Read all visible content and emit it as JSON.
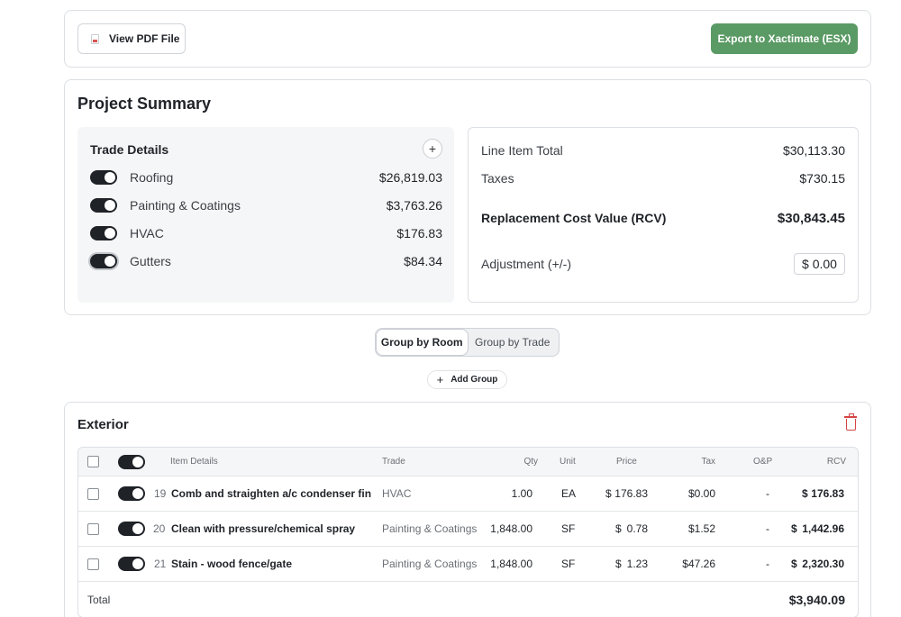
{
  "toolbar": {
    "view_pdf_label": "View PDF File",
    "export_label": "Export to Xactimate (ESX)",
    "accent_color": "#5a9a64"
  },
  "summary": {
    "title": "Project Summary",
    "trade_details": {
      "heading": "Trade Details",
      "add_icon": "plus-icon",
      "items": [
        {
          "name": "Roofing",
          "amount": "$26,819.03",
          "enabled": true
        },
        {
          "name": "Painting & Coatings",
          "amount": "$3,763.26",
          "enabled": true
        },
        {
          "name": "HVAC",
          "amount": "$176.83",
          "enabled": true
        },
        {
          "name": "Gutters",
          "amount": "$84.34",
          "enabled": true
        }
      ]
    },
    "totals": {
      "line_item_label": "Line Item Total",
      "line_item_value": "$30,113.30",
      "taxes_label": "Taxes",
      "taxes_value": "$730.15",
      "rcv_label": "Replacement Cost Value (RCV)",
      "rcv_value": "$30,843.45",
      "adjustment_label": "Adjustment (+/-)",
      "adjustment_value": "$ 0.00"
    }
  },
  "grouping": {
    "options": [
      "Group by Room",
      "Group by Trade"
    ],
    "selected": "Group by Room",
    "add_group_label": "Add Group"
  },
  "exterior": {
    "title": "Exterior",
    "delete_icon": "trash-icon",
    "columns": [
      "Item Details",
      "Trade",
      "Qty",
      "Unit",
      "Price",
      "Tax",
      "O&P",
      "RCV"
    ],
    "rows": [
      {
        "num": "19",
        "desc": "Comb and straighten a/c condenser fins ...",
        "trade": "HVAC",
        "qty": "1.00",
        "unit": "EA",
        "price_sym": "$",
        "price": "176.83",
        "tax": "$0.00",
        "op": "-",
        "rcv_sym": "$",
        "rcv": "176.83"
      },
      {
        "num": "20",
        "desc": "Clean with pressure/chemical spray",
        "trade": "Painting & Coatings",
        "qty": "1,848.00",
        "unit": "SF",
        "price_sym": "$",
        "price": "0.78",
        "tax": "$1.52",
        "op": "-",
        "rcv_sym": "$",
        "rcv": "1,442.96"
      },
      {
        "num": "21",
        "desc": "Stain - wood fence/gate",
        "trade": "Painting & Coatings",
        "qty": "1,848.00",
        "unit": "SF",
        "price_sym": "$",
        "price": "1.23",
        "tax": "$47.26",
        "op": "-",
        "rcv_sym": "$",
        "rcv": "2,320.30"
      }
    ],
    "total_label": "Total",
    "total_value": "$3,940.09"
  }
}
